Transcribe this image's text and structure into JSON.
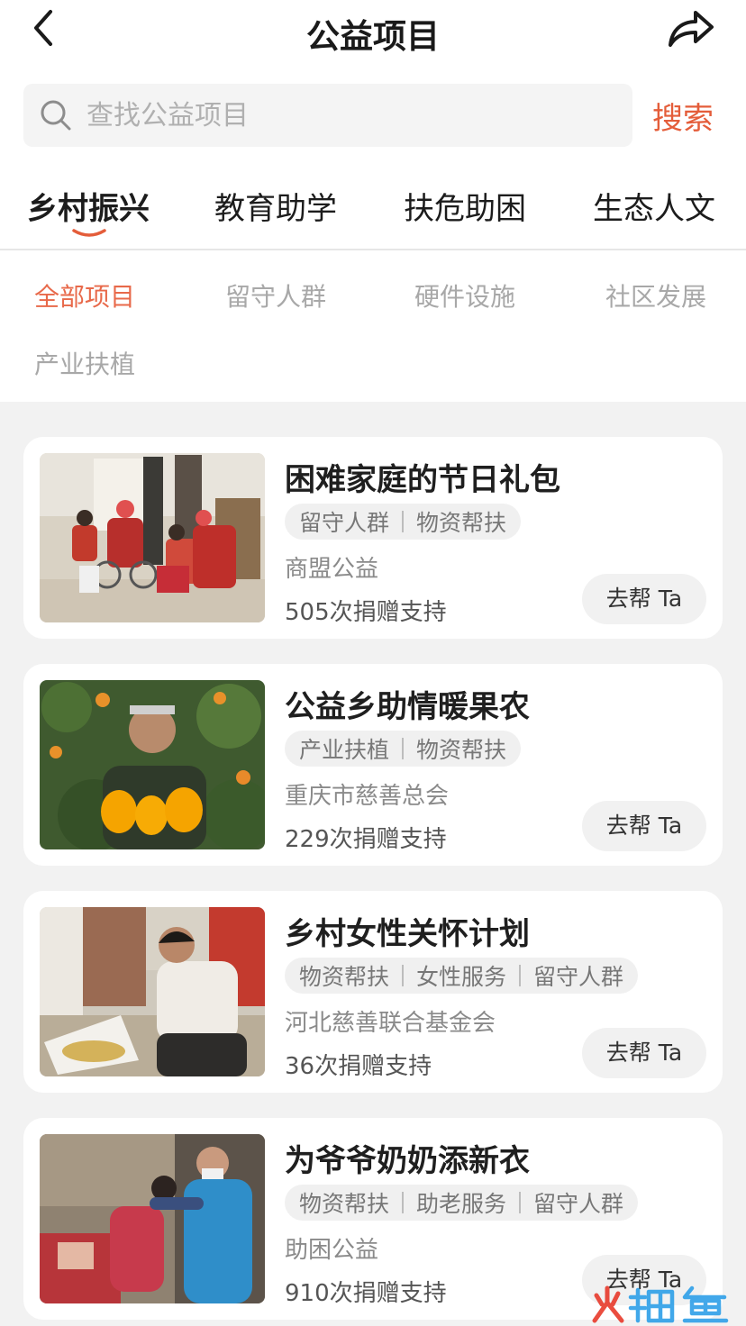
{
  "header": {
    "title": "公益项目"
  },
  "search": {
    "placeholder": "查找公益项目",
    "button_label": "搜索"
  },
  "tabs": [
    {
      "label": "乡村振兴",
      "active": true
    },
    {
      "label": "教育助学",
      "active": false
    },
    {
      "label": "扶危助困",
      "active": false
    },
    {
      "label": "生态人文",
      "active": false
    }
  ],
  "filters": [
    {
      "label": "全部项目",
      "active": true
    },
    {
      "label": "留守人群",
      "active": false
    },
    {
      "label": "硬件设施",
      "active": false
    },
    {
      "label": "社区发展",
      "active": false
    },
    {
      "label": "产业扶植",
      "active": false
    }
  ],
  "projects": [
    {
      "title": "困难家庭的节日礼包",
      "tags": [
        "留守人群",
        "物资帮扶"
      ],
      "org": "商盟公益",
      "donations": "505次捐赠支持",
      "button": "去帮 Ta"
    },
    {
      "title": "公益乡助情暖果农",
      "tags": [
        "产业扶植",
        "物资帮扶"
      ],
      "org": "重庆市慈善总会",
      "donations": "229次捐赠支持",
      "button": "去帮 Ta"
    },
    {
      "title": "乡村女性关怀计划",
      "tags": [
        "物资帮扶",
        "女性服务",
        "留守人群"
      ],
      "org": "河北慈善联合基金会",
      "donations": "36次捐赠支持",
      "button": "去帮 Ta"
    },
    {
      "title": "为爷爷奶奶添新衣",
      "tags": [
        "物资帮扶",
        "助老服务",
        "留守人群"
      ],
      "org": "助困公益",
      "donations": "910次捐赠支持",
      "button": "去帮 Ta"
    }
  ],
  "watermark": {
    "text": "火鲤鱼"
  },
  "colors": {
    "accent": "#e45d3a",
    "page_bg": "#f2f2f2",
    "card_bg": "#ffffff",
    "tag_bg": "#f0f0f0"
  }
}
